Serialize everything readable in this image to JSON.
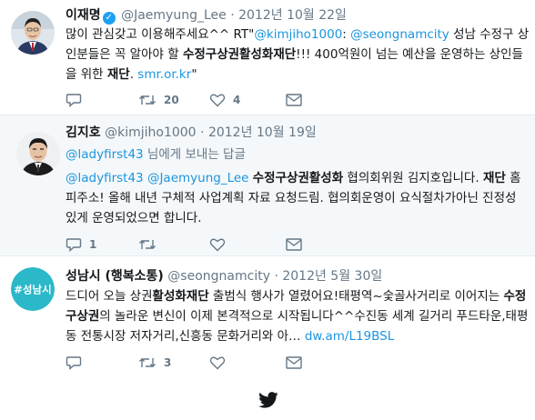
{
  "tweets": [
    {
      "name": "이재명",
      "verified": true,
      "handle": "@Jaemyung_Lee",
      "dot": "·",
      "date": "2012년 10월 22일",
      "body": {
        "p1": "많이 관심갖고 이용해주세요^^ RT\"",
        "m1": "@kimjiho1000",
        "p2": ": ",
        "m2": "@seongnamcity",
        "p3": " 성남 수정구 상인분들은 꼭 알아야 할 ",
        "b1": "수정구상권활성화재단",
        "p4": "!!! 400억원이 넘는 예산을 운영하는 상인들을 위한 ",
        "b2": "재단",
        "p5": ". ",
        "url": "smr.or.kr",
        "p6": "\""
      },
      "retweets": "20",
      "likes": "4"
    },
    {
      "name": "김지호",
      "handle": "@kimjiho1000",
      "dot": "·",
      "date": "2012년 10월 19일",
      "reply_to_handle": "@ladyfirst43",
      "reply_to_suffix": " 님에게 보내는 답글",
      "body": {
        "m1": "@ladyfirst43",
        "p1": " ",
        "m2": "@Jaemyung_Lee",
        "p2": " ",
        "b1": "수정구상권활성화",
        "p3": " 협의회위원 김지호입니다. ",
        "b2": "재단",
        "p4": " 홈피주소! 올해 내년 구체적 사업계획 자료 요청드림. 협의회운영이 요식절차가아닌 진정성있게 운영되었으면 합니다."
      },
      "replies": "1"
    },
    {
      "name": "성남시 (행복소통)",
      "handle": "@seongnamcity",
      "dot": "·",
      "date": "2012년 5월 30일",
      "avatar_text": "#성남시",
      "body": {
        "p1": "드디어 오늘 상권",
        "b1": "활성화재단",
        "p2": " 출범식 행사가 열렸어요!태평역~숯골사거리로 이어지는 ",
        "b2": "수정구상권",
        "p3": "의 놀라운 변신이 이제 본격적으로 시작됩니다^^수진동 세계 길거리 푸드타운,태평동 전통시장 저자거리,신흥동 문화거리와 아… ",
        "url": "dw.am/L19BSL"
      },
      "retweets": "3"
    }
  ],
  "footer": {
    "logo": "twitter-bird-icon"
  },
  "colors": {
    "link": "#1b95e0",
    "muted": "#657786",
    "verified": "#1da1f2",
    "seongnam_avatar": "#2bb8c8"
  }
}
